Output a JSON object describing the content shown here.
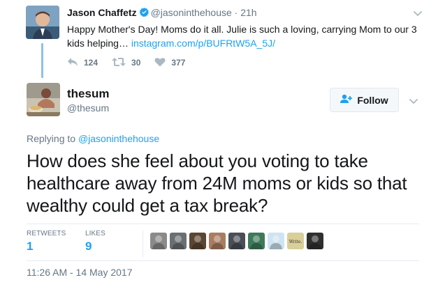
{
  "parent_tweet": {
    "name": "Jason Chaffetz",
    "handle": "@jasoninthehouse",
    "separator": "·",
    "time": "21h",
    "text": "Happy Mother's Day! Moms do it all. Julie is such a loving, carrying Mom to our 3 kids helping… ",
    "link": "instagram.com/p/BUFRtW5A_5J/",
    "replies": "124",
    "retweets": "30",
    "likes": "377"
  },
  "main_tweet": {
    "name": "thesum",
    "handle": "@thesum",
    "follow_label": "Follow",
    "replying_prefix": "Replying to ",
    "replying_to": "@jasoninthehouse",
    "text": "How does she feel about you voting to take healthcare away from 24M moms  or kids so that wealthy could get a tax break?",
    "retweets_label": "RETWEETS",
    "retweets_count": "1",
    "likes_label": "LIKES",
    "likes_count": "9",
    "timestamp": "11:26 AM - 14 May 2017",
    "likers": [
      {
        "color": "#8a8a8a"
      },
      {
        "color": "#6b6f73"
      },
      {
        "color": "#5b4632"
      },
      {
        "color": "#a97d62"
      },
      {
        "color": "#4a4f57"
      },
      {
        "color": "#3e7a5a"
      },
      {
        "color": "#cfe4f1"
      },
      {
        "color": "#d8cf9a",
        "text": "Write."
      },
      {
        "color": "#2f2f2f"
      }
    ]
  },
  "colors": {
    "link": "#1da1f2",
    "muted": "#657786",
    "thread_line": "#8fc1e3"
  }
}
